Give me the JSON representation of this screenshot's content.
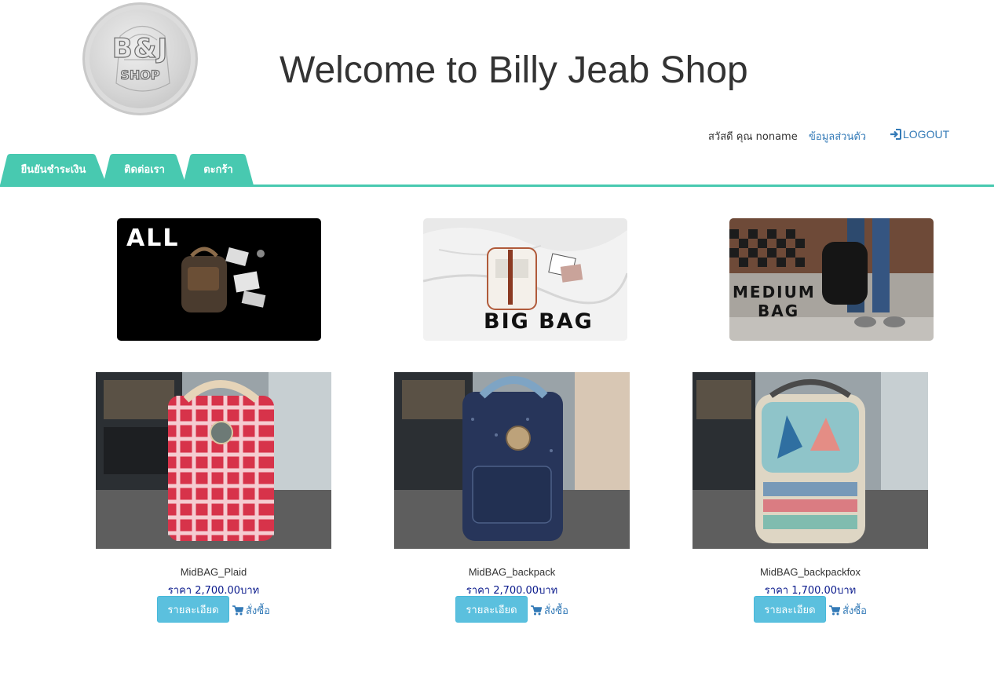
{
  "header": {
    "logo_line1": "B&J",
    "logo_line2": "SHOP",
    "title": "Welcome to Billy Jeab Shop"
  },
  "user_bar": {
    "greeting": "สวัสดี คุณ noname",
    "profile_label": "ข้อมูลส่วนตัว",
    "logout_label": "LOGOUT",
    "logout_icon": "log-in-icon"
  },
  "tabs": [
    {
      "label": "ยืนยันชำระเงิน"
    },
    {
      "label": "ติดต่อเรา"
    },
    {
      "label": "ตะกร้า"
    }
  ],
  "categories": [
    {
      "label": "ALL"
    },
    {
      "label": "BIG BAG"
    },
    {
      "label_line1": "MEDIUM",
      "label_line2": "BAG"
    }
  ],
  "products": [
    {
      "name": "MidBAG_Plaid",
      "price": "ราคา 2,700.00บาท",
      "detail_label": "รายละเอียด",
      "order_label": "สั่งซื้อ"
    },
    {
      "name": "MidBAG_backpack",
      "price": "ราคา 2,700.00บาท",
      "detail_label": "รายละเอียด",
      "order_label": "สั่งซื้อ"
    },
    {
      "name": "MidBAG_backpackfox",
      "price": "ราคา 1,700.00บาท",
      "detail_label": "รายละเอียด",
      "order_label": "สั่งซื้อ"
    }
  ],
  "colors": {
    "accent": "#48c9b0",
    "link": "#337ab7",
    "price": "#0a1a8c",
    "info_button": "#5bc0de"
  },
  "icons": {
    "cart": "shopping-cart-icon"
  }
}
